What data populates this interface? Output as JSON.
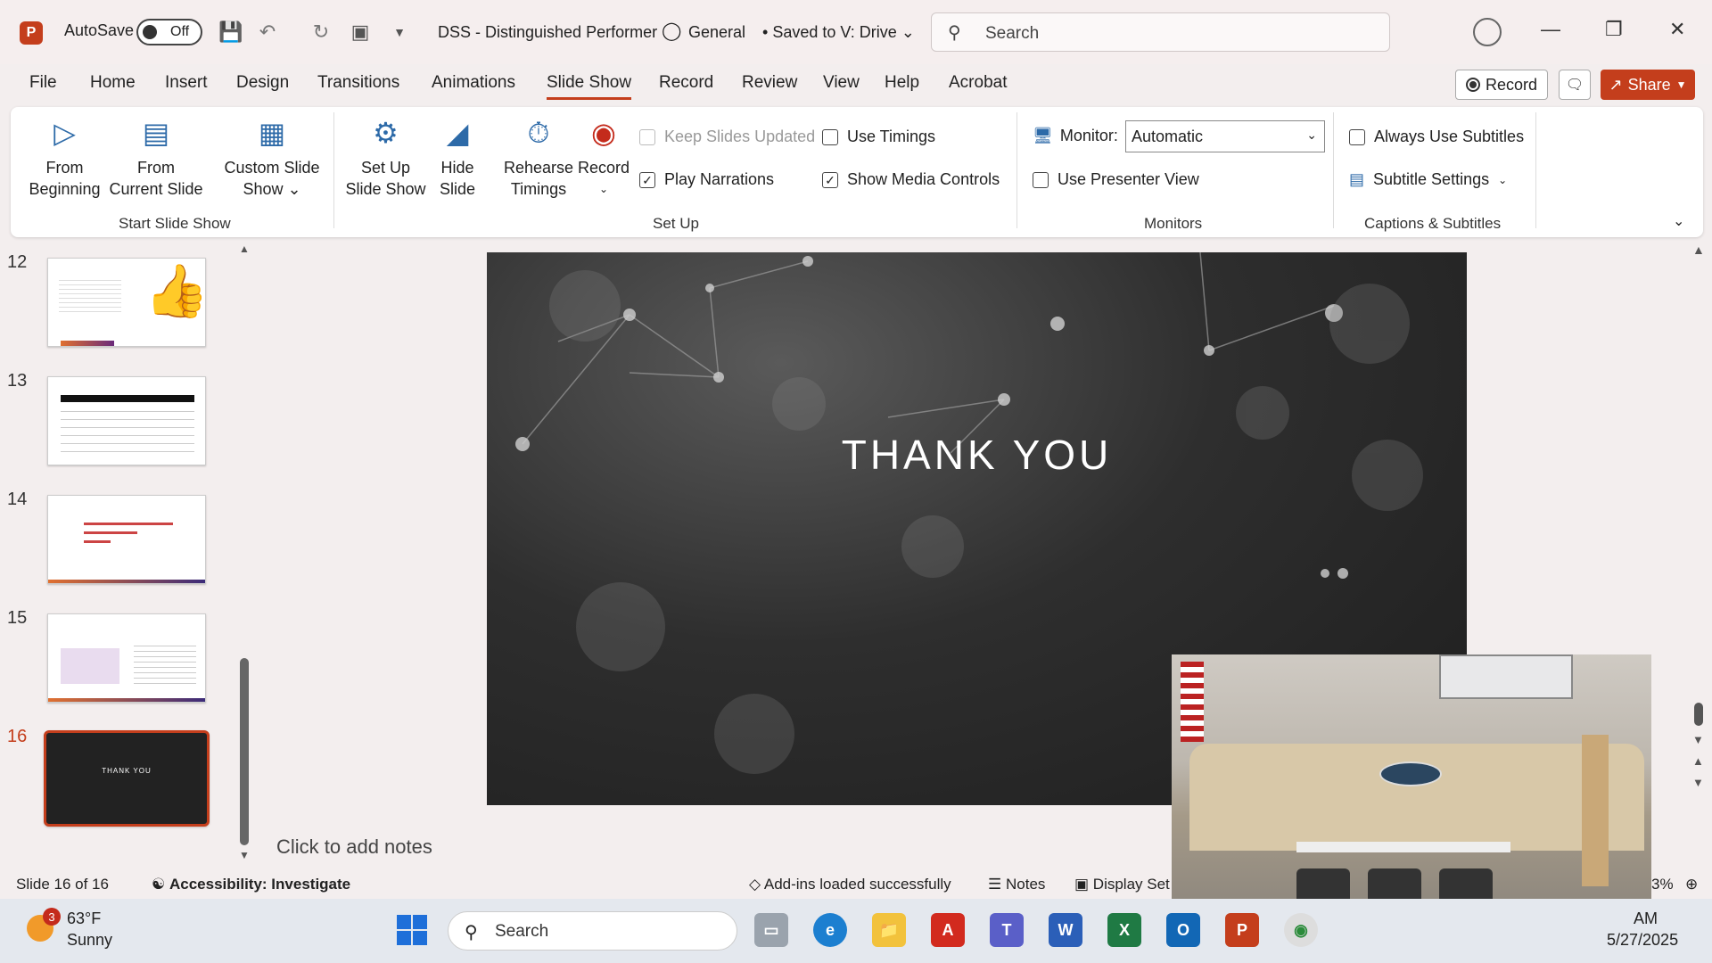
{
  "titlebar": {
    "autosave_label": "AutoSave",
    "autosave_state": "Off",
    "doc_title": "DSS - Distinguished Performer",
    "sensitivity": "General",
    "save_status": "Saved to V: Drive",
    "search_placeholder": "Search"
  },
  "tabs": [
    "File",
    "Home",
    "Insert",
    "Design",
    "Transitions",
    "Animations",
    "Slide Show",
    "Record",
    "Review",
    "View",
    "Help",
    "Acrobat"
  ],
  "active_tab": "Slide Show",
  "header_buttons": {
    "record": "Record",
    "share": "Share"
  },
  "ribbon": {
    "from_beginning": [
      "From",
      "Beginning"
    ],
    "from_current": [
      "From",
      "Current Slide"
    ],
    "custom_show": [
      "Custom Slide",
      "Show"
    ],
    "start_group": "Start Slide Show",
    "setup_show": [
      "Set Up",
      "Slide Show"
    ],
    "hide_slide": [
      "Hide",
      "Slide"
    ],
    "rehearse": [
      "Rehearse",
      "Timings"
    ],
    "record": "Record",
    "keep_updated": "Keep Slides Updated",
    "play_narrations": "Play Narrations",
    "use_timings": "Use Timings",
    "show_media": "Show Media Controls",
    "setup_group": "Set Up",
    "monitor_label": "Monitor:",
    "monitor_value": "Automatic",
    "presenter_view": "Use Presenter View",
    "monitors_group": "Monitors",
    "always_subtitles": "Always Use Subtitles",
    "subtitle_settings": "Subtitle Settings",
    "captions_group": "Captions & Subtitles"
  },
  "thumbnails": [
    {
      "num": "12",
      "label": ""
    },
    {
      "num": "13",
      "label": ""
    },
    {
      "num": "14",
      "label": ""
    },
    {
      "num": "15",
      "label": ""
    },
    {
      "num": "16",
      "label": "THANK YOU"
    }
  ],
  "slide": {
    "title": "THANK YOU"
  },
  "notes_placeholder": "Click to add notes",
  "status": {
    "slide_count": "Slide 16 of 16",
    "accessibility": "Accessibility: Investigate",
    "addins": "Add-ins loaded successfully",
    "notes": "Notes",
    "display": "Display Set",
    "zoom": "3%"
  },
  "taskbar": {
    "badge": "3",
    "temp": "63°F",
    "condition": "Sunny",
    "search": "Search",
    "time": "AM",
    "date": "5/27/2025"
  },
  "colors": {
    "accent": "#c43e1c",
    "ribbon_icon": "#2d6aa8"
  }
}
